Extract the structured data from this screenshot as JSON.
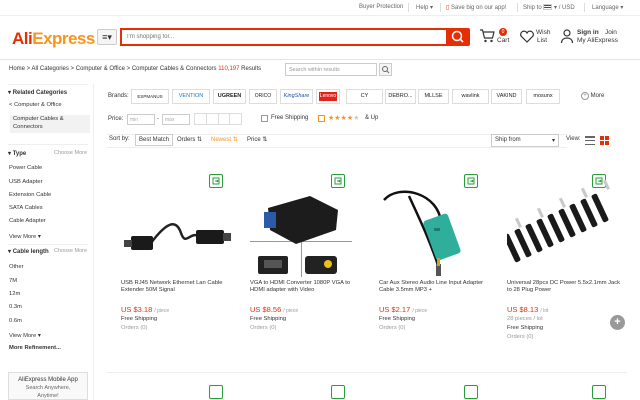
{
  "topbar": {
    "buyer_protection": "Buyer Protection",
    "help": "Help",
    "save_app": "Save big on our app!",
    "ship_to": "Ship to",
    "currency": "USD",
    "language": "Language"
  },
  "header": {
    "logo_a": "Ali",
    "logo_b": "Express",
    "search_placeholder": "I'm shopping for...",
    "cart_label": "Cart",
    "cart_count": "0",
    "wish_label1": "Wish",
    "wish_label2": "List",
    "signin": "Sign in",
    "join": "Join",
    "my_ae": "My AliExpress"
  },
  "breadcrumb": {
    "home": "Home",
    "all_categories": "All Categories",
    "computer_office": "Computer & Office",
    "current": "Computer Cables & Connectors",
    "count": "110,197",
    "results": "Results",
    "search_within_placeholder": "Search within results"
  },
  "sidebar": {
    "related_categories": "Related Categories",
    "parent": "< Computer & Office",
    "current_cat_1": "Computer Cables &",
    "current_cat_2": "Connectors",
    "type_label": "Type",
    "choose_more": "Choose More",
    "types": [
      "Power Cable",
      "USB Adapter",
      "Extension Cable",
      "SATA Cables",
      "Cable Adapter"
    ],
    "view_more": "View More",
    "cable_length_label": "Cable length",
    "lengths": [
      "Other",
      "7M",
      "12m",
      "0.3m",
      "0.6m"
    ],
    "more_refinement": "More Refinement...",
    "mobile_app": "AliExpress Mobile App",
    "mobile_sub1": "Search Anywhere,",
    "mobile_sub2": "Anytime!"
  },
  "filters": {
    "brands_label": "Brands:",
    "brands": [
      "ESPMANUS",
      "VENTION",
      "UGREEN",
      "ORICO",
      "KingShare",
      "Lenovo",
      "CY",
      "DEBRO...",
      "MLLSE",
      "wavlink",
      "VAKIND",
      "mosunx"
    ],
    "brand_more": "More",
    "price_label": "Price:",
    "price_min": "min",
    "price_max": "max",
    "free_shipping": "Free Shipping",
    "stars_up": "& Up",
    "sort_by": "Sort by:",
    "best_match": "Best Match",
    "orders": "Orders",
    "newest": "Newest",
    "price": "Price",
    "ship_from": "Ship from",
    "view": "View:"
  },
  "products": [
    {
      "title": "USB RJ45 Network Ethernet Lan Cable Extender 50M Signal",
      "price": "US $3.18",
      "unit": "/ piece",
      "shipping": "Free Shipping",
      "extra": "",
      "orders": "Orders (0)"
    },
    {
      "title": "VGA to HDMI Converter 1080P VGA to HDMI adapter with Video",
      "price": "US $8.56",
      "unit": "/ piece",
      "shipping": "Free Shipping",
      "extra": "",
      "orders": "Orders (0)"
    },
    {
      "title": "Car Aux Stereo Audio Line Input Adapter Cable 3.5mm MP3 +",
      "price": "US $2.17",
      "unit": "/ piece",
      "shipping": "Free Shipping",
      "extra": "",
      "orders": "Orders (0)"
    },
    {
      "title": "Universal 28pcs DC Power 5.5x2.1mm Jack to 28 Plug Power",
      "price": "US $8.13",
      "unit": "/ lot",
      "shipping": "Free Shipping",
      "extra": "28 pieces / lot",
      "orders": "Orders (0)"
    }
  ],
  "colors": {
    "accent": "#e62e04",
    "orange": "#f7941d",
    "green": "#2a9d3a"
  }
}
